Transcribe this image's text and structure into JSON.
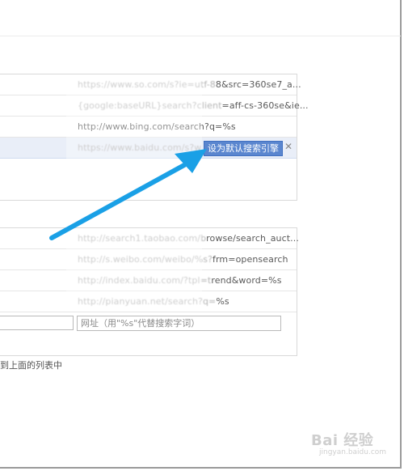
{
  "default_engines": [
    {
      "url_visible": "https://www.so.com/s?ie=utf-8",
      "url_rest": "8&src=360se7_a..."
    },
    {
      "url_visible": "{google:baseURL}search?client",
      "url_rest": "=aff-cs-360se&ie..."
    },
    {
      "url_visible": "http://www.bing.com/search?",
      "url_rest": "q=%s"
    },
    {
      "url_visible": "https://www.baidu.com/s?w",
      "url_rest": ""
    }
  ],
  "make_default_label": "设为默认搜索引擎",
  "close_glyph": "✕",
  "other_engines": [
    {
      "url_visible": "http://search1.taobao.com/b",
      "url_rest": "rowse/search_auct..."
    },
    {
      "url_visible": "http://s.weibo.com/weibo/%s?",
      "url_rest": "frm=opensearch"
    },
    {
      "url_visible": "http://index.baidu.com/?tpl=t",
      "url_rest": "rend&word=%s"
    },
    {
      "url_visible": "http://pianyuan.net/search?q=",
      "url_rest": "%s"
    }
  ],
  "url_input_placeholder": "网址（用\"%s\"代替搜索字词）",
  "hint_text": "到上面的列表中",
  "watermark": {
    "main": "Bai 经验",
    "sub": "jingyan.baidu.com"
  },
  "colors": {
    "accent": "#5a86cf",
    "arrow": "#1aa0e6",
    "highlight_row": "#e9eef8"
  },
  "icons": {
    "arrow": "pointer-arrow-icon",
    "close": "close-icon"
  }
}
